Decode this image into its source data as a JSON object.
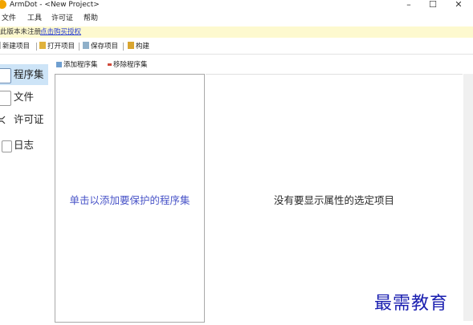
{
  "window": {
    "title": "ArmDot - <New Project>",
    "minimize": "–",
    "maximize": "☐",
    "close": "✕"
  },
  "menu": [
    "文件",
    "工具",
    "许可证",
    "帮助"
  ],
  "notice": {
    "text": "此版本未注册",
    "link": "点击购买授权"
  },
  "toolbar": {
    "new_project": "新建项目",
    "open_project": "打开项目",
    "save_project": "保存项目",
    "build": "构建"
  },
  "sidebar": {
    "items": [
      {
        "label": "程序集",
        "icon": "assembly-icon"
      },
      {
        "label": "文件",
        "icon": "file-icon"
      },
      {
        "label": "许可证",
        "icon": "license-icon"
      },
      {
        "label": "日志",
        "icon": "log-icon"
      }
    ]
  },
  "assemblies": {
    "add_label": "添加程序集",
    "remove_label": "移除程序集",
    "empty_hint": "单击以添加要保护的程序集"
  },
  "properties": {
    "empty_text": "没有要显示属性的选定项目"
  },
  "watermark": "最需教育",
  "colors": {
    "notice_bg": "#fdf9cf",
    "link": "#2a3fd4",
    "hint_text": "#4a55c8",
    "selected_bg": "#cde4f7"
  }
}
